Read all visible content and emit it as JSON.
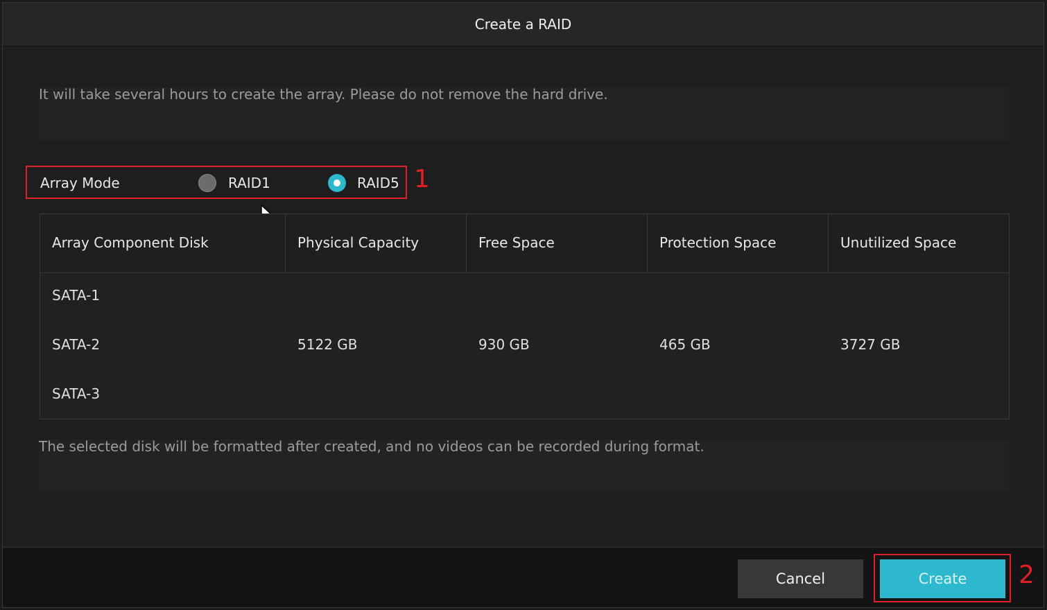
{
  "dialog": {
    "title": "Create a RAID",
    "notice_top": "It will take several hours to create the array. Please do not remove the hard drive.",
    "notice_bottom": "The selected disk will be formatted after created, and no videos can be recorded during format."
  },
  "array_mode": {
    "label": "Array Mode",
    "options": [
      {
        "label": "RAID1",
        "selected": false
      },
      {
        "label": "RAID5",
        "selected": true
      }
    ]
  },
  "annotations": {
    "step1": "1",
    "step2": "2",
    "highlight_color": "#e02027"
  },
  "table": {
    "headers": [
      "Array Component Disk",
      "Physical Capacity",
      "Free Space",
      "Protection Space",
      "Unutilized Space"
    ],
    "disks": [
      "SATA-1",
      "SATA-2",
      "SATA-3"
    ],
    "summary": {
      "physical_capacity": "5122 GB",
      "free_space": "930 GB",
      "protection_space": "465 GB",
      "unutilized_space": "3727 GB"
    }
  },
  "buttons": {
    "cancel": "Cancel",
    "create": "Create"
  },
  "colors": {
    "accent": "#2db8cd",
    "background": "#1e1e1e"
  }
}
